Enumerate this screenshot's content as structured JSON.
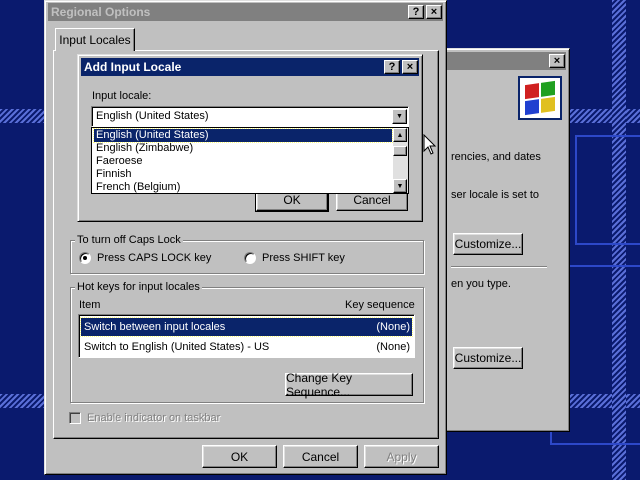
{
  "background_window": {
    "text_currencies": "rencies, and dates",
    "text_user_locale": "ser locale is set to",
    "text_type": "en you type.",
    "customize_1": "Customize...",
    "customize_2": "Customize..."
  },
  "regional_options": {
    "title": "Regional Options",
    "help": "?",
    "close": "×",
    "tab_label": "Input Locales",
    "caps_lock_group": "To turn off Caps Lock",
    "radio_caps": "Press CAPS LOCK key",
    "radio_shift": "Press SHIFT key",
    "hotkeys_group": "Hot keys for input locales",
    "col_item": "Item",
    "col_key": "Key sequence",
    "hotkeys": [
      {
        "item": "Switch between input locales",
        "key": "(None)"
      },
      {
        "item": "Switch to English (United States) - US",
        "key": "(None)"
      }
    ],
    "change_key_sequence": "Change Key Sequence...",
    "enable_indicator": "Enable indicator on taskbar",
    "ok": "OK",
    "cancel": "Cancel",
    "apply": "Apply"
  },
  "add_input_locale": {
    "title": "Add Input Locale",
    "help": "?",
    "close": "×",
    "input_locale_label": "Input locale:",
    "selected_value": "English (United States)",
    "options": [
      "English (United States)",
      "English (Zimbabwe)",
      "Faeroese",
      "Finnish",
      "French (Belgium)"
    ],
    "ok": "OK",
    "cancel": "Cancel"
  }
}
